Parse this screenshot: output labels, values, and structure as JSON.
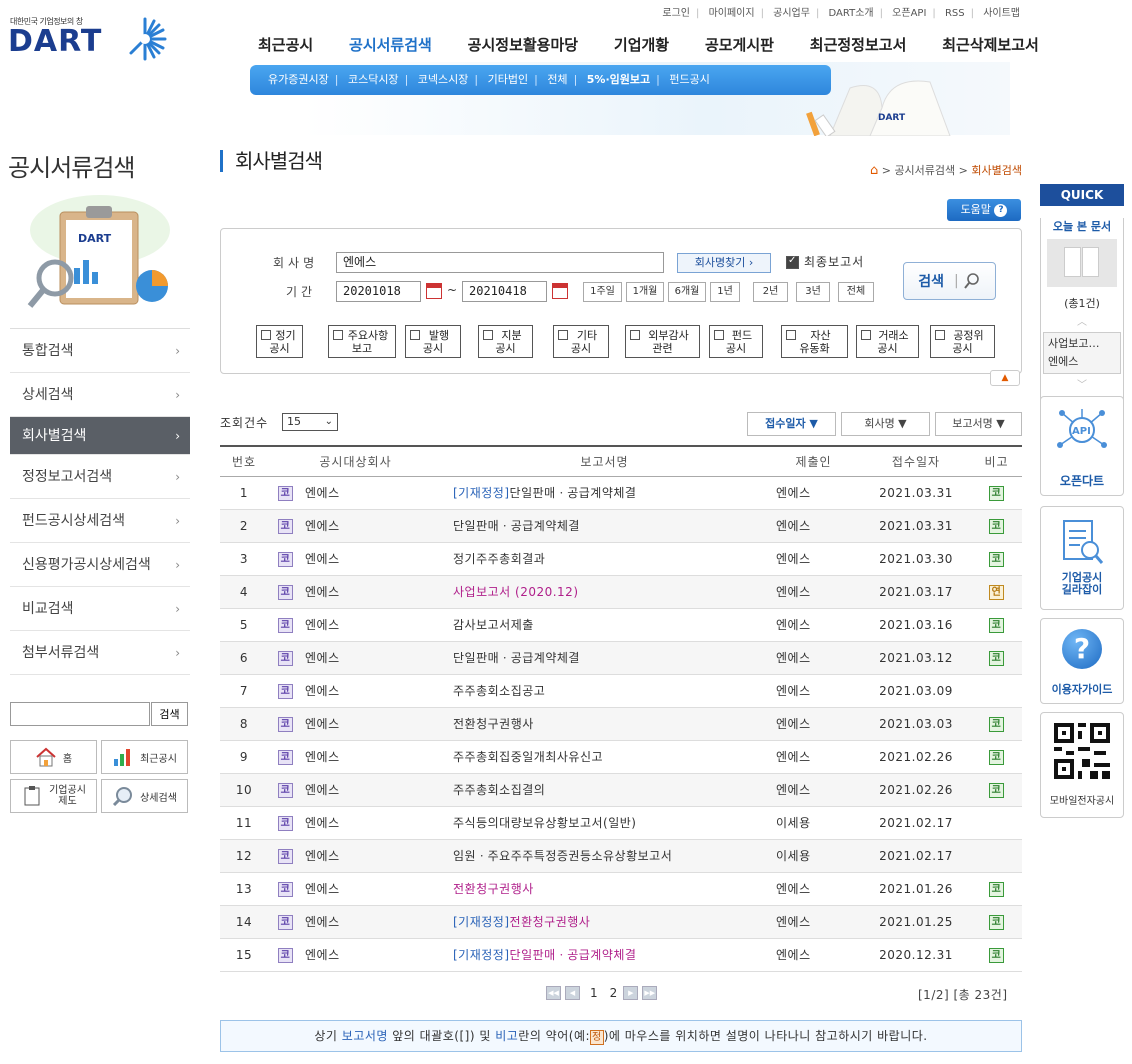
{
  "header": {
    "util_links": [
      "로그인",
      "마이페이지",
      "공시업무",
      "DART소개",
      "오픈API",
      "RSS",
      "사이트맵"
    ],
    "logo_tagline": "대한민국 기업정보의 창",
    "logo_text": "DART",
    "gnb": [
      "최근공시",
      "공시서류검색",
      "공시정보활용마당",
      "기업개황",
      "공모게시판",
      "최근정정보고서",
      "최근삭제보고서"
    ],
    "gnb_active": 1,
    "subnav": [
      "유가증권시장",
      "코스닥시장",
      "코넥스시장",
      "기타법인",
      "전체",
      "5%·임원보고",
      "펀드공시"
    ],
    "banner_book_text": "DART"
  },
  "left_nav": {
    "title": "공시서류검색",
    "clip_text": "DART",
    "items": [
      {
        "label": "통합검색",
        "active": false
      },
      {
        "label": "상세검색",
        "active": false
      },
      {
        "label": "회사별검색",
        "active": true
      },
      {
        "label": "정정보고서검색",
        "active": false
      },
      {
        "label": "펀드공시상세검색",
        "active": false
      },
      {
        "label": "신용평가공시상세검색",
        "active": false
      },
      {
        "label": "비교검색",
        "active": false
      },
      {
        "label": "첨부서류검색",
        "active": false
      }
    ],
    "arrow": "›",
    "search_button": "검색",
    "quick_buttons": [
      "홈",
      "최근공시",
      "기업공시\n제도",
      "상세검색"
    ]
  },
  "main": {
    "title": "회사별검색",
    "breadcrumb": [
      "공시서류검색",
      "회사별검색"
    ],
    "breadcrumb_sep": ">",
    "help_label": "도움말",
    "form": {
      "company_label": "회사명",
      "company_value": "엔에스",
      "find_button": "회사명찾기 ›",
      "final_report_label": "최종보고서",
      "final_report_checked": true,
      "period_label": "기간",
      "date_from": "20201018",
      "date_sep": "~",
      "date_to": "20210418",
      "period_buttons": [
        "1주일",
        "1개월",
        "6개월",
        "1년",
        "2년",
        "3년",
        "전체"
      ],
      "search_button": "검색",
      "types": [
        "정기\n공시",
        "주요사항\n보고",
        "발행\n공시",
        "지분\n공시",
        "기타\n공시",
        "외부감사\n관련",
        "펀드\n공시",
        "자산\n유동화",
        "거래소\n공시",
        "공정위\n공시"
      ],
      "collapse_icon": "▲"
    },
    "results": {
      "count_label": "조회건수",
      "count_value": "15",
      "sort_buttons": [
        "접수일자 ▼",
        "회사명 ▼",
        "보고서명 ▼"
      ],
      "sort_active": 0,
      "columns": [
        "번호",
        "공시대상회사",
        "보고서명",
        "제출인",
        "접수일자",
        "비고"
      ],
      "rows": [
        {
          "no": "1",
          "market": "코",
          "company": "엔에스",
          "report_prefix": "[기재정정]",
          "report": "단일판매ㆍ공급계약체결",
          "report_color": "normal",
          "submitter": "엔에스",
          "date": "2021.03.31",
          "note": "코"
        },
        {
          "no": "2",
          "market": "코",
          "company": "엔에스",
          "report_prefix": "",
          "report": "단일판매ㆍ공급계약체결",
          "report_color": "normal",
          "submitter": "엔에스",
          "date": "2021.03.31",
          "note": "코"
        },
        {
          "no": "3",
          "market": "코",
          "company": "엔에스",
          "report_prefix": "",
          "report": "정기주주총회결과",
          "report_color": "normal",
          "submitter": "엔에스",
          "date": "2021.03.30",
          "note": "코"
        },
        {
          "no": "4",
          "market": "코",
          "company": "엔에스",
          "report_prefix": "",
          "report": "사업보고서 (2020.12)",
          "report_color": "magenta",
          "submitter": "엔에스",
          "date": "2021.03.17",
          "note": "연"
        },
        {
          "no": "5",
          "market": "코",
          "company": "엔에스",
          "report_prefix": "",
          "report": "감사보고서제출",
          "report_color": "normal",
          "submitter": "엔에스",
          "date": "2021.03.16",
          "note": "코"
        },
        {
          "no": "6",
          "market": "코",
          "company": "엔에스",
          "report_prefix": "",
          "report": "단일판매ㆍ공급계약체결",
          "report_color": "normal",
          "submitter": "엔에스",
          "date": "2021.03.12",
          "note": "코"
        },
        {
          "no": "7",
          "market": "코",
          "company": "엔에스",
          "report_prefix": "",
          "report": "주주총회소집공고",
          "report_color": "normal",
          "submitter": "엔에스",
          "date": "2021.03.09",
          "note": ""
        },
        {
          "no": "8",
          "market": "코",
          "company": "엔에스",
          "report_prefix": "",
          "report": "전환청구권행사",
          "report_color": "normal",
          "submitter": "엔에스",
          "date": "2021.03.03",
          "note": "코"
        },
        {
          "no": "9",
          "market": "코",
          "company": "엔에스",
          "report_prefix": "",
          "report": "주주총회집중일개최사유신고",
          "report_color": "normal",
          "submitter": "엔에스",
          "date": "2021.02.26",
          "note": "코"
        },
        {
          "no": "10",
          "market": "코",
          "company": "엔에스",
          "report_prefix": "",
          "report": "주주총회소집결의",
          "report_color": "normal",
          "submitter": "엔에스",
          "date": "2021.02.26",
          "note": "코"
        },
        {
          "no": "11",
          "market": "코",
          "company": "엔에스",
          "report_prefix": "",
          "report": "주식등의대량보유상황보고서(일반)",
          "report_color": "normal",
          "submitter": "이세용",
          "date": "2021.02.17",
          "note": ""
        },
        {
          "no": "12",
          "market": "코",
          "company": "엔에스",
          "report_prefix": "",
          "report": "임원ㆍ주요주주특정증권등소유상황보고서",
          "report_color": "normal",
          "submitter": "이세용",
          "date": "2021.02.17",
          "note": ""
        },
        {
          "no": "13",
          "market": "코",
          "company": "엔에스",
          "report_prefix": "",
          "report": "전환청구권행사",
          "report_color": "magenta",
          "submitter": "엔에스",
          "date": "2021.01.26",
          "note": "코"
        },
        {
          "no": "14",
          "market": "코",
          "company": "엔에스",
          "report_prefix": "[기재정정]",
          "report": "전환청구권행사",
          "report_color": "magenta",
          "submitter": "엔에스",
          "date": "2021.01.25",
          "note": "코"
        },
        {
          "no": "15",
          "market": "코",
          "company": "엔에스",
          "report_prefix": "[기재정정]",
          "report": "단일판매ㆍ공급계약체결",
          "report_color": "magenta",
          "submitter": "엔에스",
          "date": "2020.12.31",
          "note": "코"
        }
      ]
    },
    "paging": {
      "pages": [
        "1",
        "2"
      ],
      "info": "[1/2] [총 23건]"
    },
    "notice": {
      "part1": "상기 ",
      "link1": "보고서명",
      "part2": " 앞의 대괄호([]) 및 ",
      "link2": "비고",
      "part3": "란의 약어(예:",
      "example": "정",
      "part4": ")에 마우스를 위치하면 설명이 나타나니 참고하시기 바랍니다."
    }
  },
  "quick": {
    "title": "QUICK",
    "recent_label": "오늘 본 문서",
    "recent_count": "(총1건)",
    "recent_item_line1": "사업보고…",
    "recent_item_line2": "엔에스",
    "api_label": "오픈다트",
    "api_icon_text": "API",
    "guide_label": "기업공시\n길라잡이",
    "user_guide_label": "이용자가이드",
    "mobile_label": "모바일전자공시"
  },
  "colors": {
    "brand_navy": "#1b3d8f",
    "accent_blue": "#1f71c8",
    "nav_active_bg": "#5a5f66",
    "report_magenta": "#b0208b",
    "report_blue": "#2a63b8"
  }
}
